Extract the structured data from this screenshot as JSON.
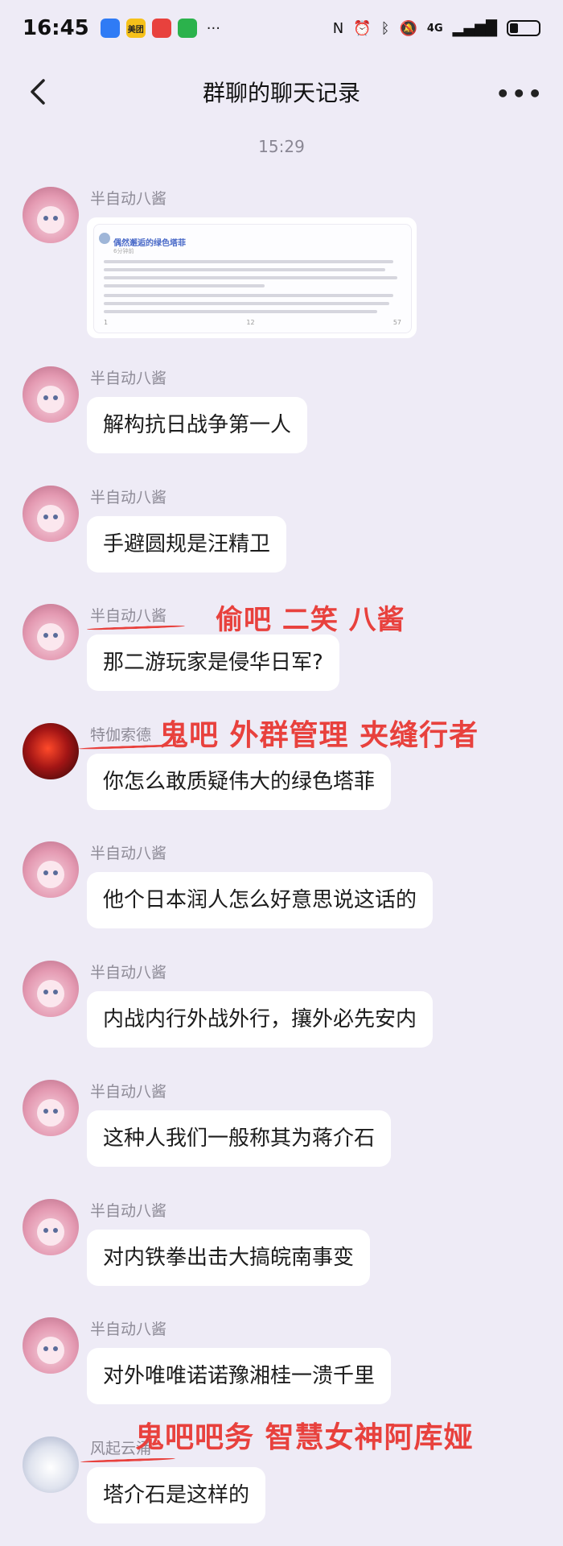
{
  "status_bar": {
    "time": "16:45",
    "apps": [
      {
        "icon": "blue-app-icon",
        "color": "#2f7bf5",
        "text": ""
      },
      {
        "icon": "meituan-app-icon",
        "color": "#f6c11a",
        "text": "美团"
      },
      {
        "icon": "red-app-icon",
        "color": "#e8413d",
        "text": ""
      },
      {
        "icon": "wechat-app-icon",
        "color": "#2bb24c",
        "text": ""
      }
    ],
    "network": "4G",
    "more": "···"
  },
  "nav": {
    "title": "群聊的聊天记录",
    "more": "•••"
  },
  "timestamp": "15:29",
  "messages": [
    {
      "sender": "半自动八酱",
      "type": "image",
      "avatar": "pink-hair-avatar",
      "card": {
        "title": "偶然邂逅的绿色塔菲",
        "sub": "6分钟前",
        "stats": [
          "1",
          "12",
          "57"
        ]
      }
    },
    {
      "sender": "半自动八酱",
      "text": "解构抗日战争第一人",
      "avatar": "pink-hair-avatar"
    },
    {
      "sender": "半自动八酱",
      "text": "手避圆规是汪精卫",
      "avatar": "pink-hair-avatar"
    },
    {
      "sender": "半自动八酱",
      "text": "那二游玩家是侵华日军?",
      "avatar": "pink-hair-avatar"
    },
    {
      "sender": "特伽索德",
      "text": "你怎么敢质疑伟大的绿色塔菲",
      "avatar": "red-avatar"
    },
    {
      "sender": "半自动八酱",
      "text": "他个日本润人怎么好意思说这话的",
      "avatar": "pink-hair-avatar"
    },
    {
      "sender": "半自动八酱",
      "text": "内战内行外战外行，攘外必先安内",
      "avatar": "pink-hair-avatar"
    },
    {
      "sender": "半自动八酱",
      "text": "这种人我们一般称其为蒋介石",
      "avatar": "pink-hair-avatar"
    },
    {
      "sender": "半自动八酱",
      "text": "对内铁拳出击大搞皖南事变",
      "avatar": "pink-hair-avatar"
    },
    {
      "sender": "半自动八酱",
      "text": "对外唯唯诺诺豫湘桂一溃千里",
      "avatar": "pink-hair-avatar"
    },
    {
      "sender": "风起云涌",
      "text": "塔介石是这样的",
      "avatar": "white-hair-avatar"
    }
  ],
  "annotations": [
    "偷吧 二笑 八酱",
    "鬼吧 外群管理 夹缝行者",
    "鬼吧吧务 智慧女神阿库娅"
  ],
  "colors": {
    "background": "#eeebf6",
    "bubble": "#ffffff",
    "annotation": "#e8413d",
    "sender": "#8e8b97"
  }
}
